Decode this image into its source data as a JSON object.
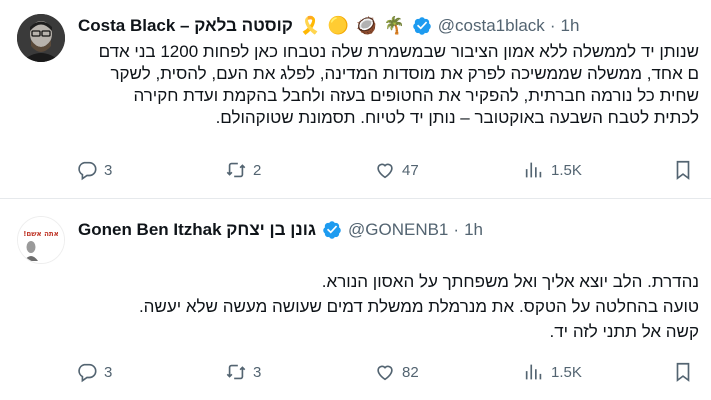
{
  "tweets": [
    {
      "display_name": "Costa Black – קוסטה בלאק",
      "emoji": [
        "🎗️",
        "🟡",
        "🥥",
        "🌴"
      ],
      "handle": "@costa1black",
      "time": "1h",
      "lines": [
        "שנותן יד לממשלה ללא אמון הציבור שבמשמרת שלה נטבחו כאן לפחות 1200 בני אדם",
        "ם אחד, ממשלה שממשיכה לפרק את מוסדות המדינה, לפלג את העם, להסית, לשקר",
        "שחית כל נורמה חברתית, להפקיר את החטופים בעזה ולחבל בהקמת ועדת חקירה",
        "לכתית לטבח השבעה באוקטובר – נותן יד לטיוח. תסמונת שטוקהולם."
      ],
      "replies": "3",
      "retweets": "2",
      "likes": "47",
      "views": "1.5K"
    },
    {
      "display_name": "Gonen Ben Itzhak גונן בן יצחק",
      "handle": "@GONENB1",
      "time": "1h",
      "avatar_text": "אתה אשם!",
      "lines": [
        "נהדרת. הלב יוצא אליך ואל משפחתך על האסון הנורא.",
        "טועה בהחלטה על הטקס. את מנרמלת ממשלת דמים שעושה מעשה שלא יעשה.",
        "קשה אל תתני לזה יד."
      ],
      "replies": "3",
      "retweets": "3",
      "likes": "82",
      "views": "1.5K"
    }
  ],
  "colors": {
    "verified": "#1d9bf0",
    "muted": "#536471",
    "divider": "#e6e9ec"
  },
  "icons": [
    "reply-icon",
    "retweet-icon",
    "like-icon",
    "views-icon",
    "bookmark-icon",
    "verified-icon"
  ]
}
